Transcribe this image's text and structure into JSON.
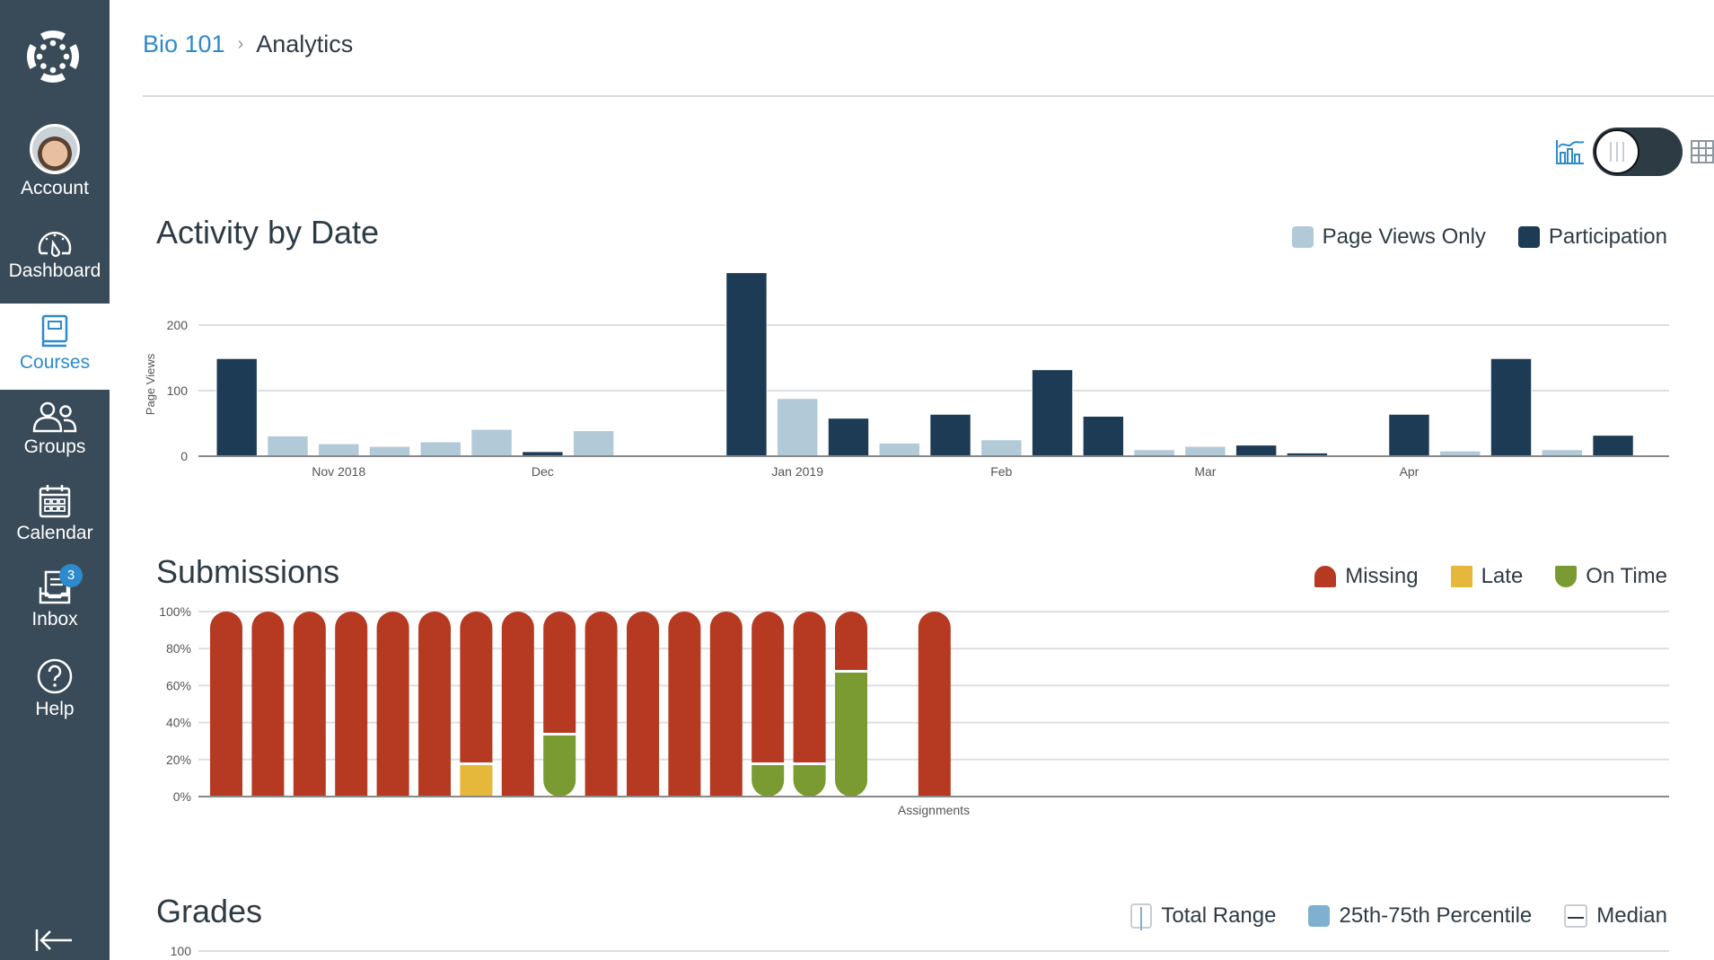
{
  "sidebar": {
    "items": [
      {
        "id": "account",
        "label": "Account",
        "icon": "avatar"
      },
      {
        "id": "dashboard",
        "label": "Dashboard",
        "icon": "speedometer-icon"
      },
      {
        "id": "courses",
        "label": "Courses",
        "icon": "book-icon",
        "active": true
      },
      {
        "id": "groups",
        "label": "Groups",
        "icon": "people-icon"
      },
      {
        "id": "calendar",
        "label": "Calendar",
        "icon": "calendar-icon"
      },
      {
        "id": "inbox",
        "label": "Inbox",
        "icon": "inbox-icon",
        "badge": "3"
      },
      {
        "id": "help",
        "label": "Help",
        "icon": "question-circle-icon"
      }
    ],
    "collapse_icon": "collapse-arrow-icon"
  },
  "breadcrumb": {
    "course": "Bio 101",
    "separator": "›",
    "current": "Analytics"
  },
  "view_toggle": {
    "left_icon": "chart-icon",
    "right_icon": "table-grid-icon",
    "state": "chart"
  },
  "colors": {
    "sidebar_bg": "#394b58",
    "accent": "#2d8acb",
    "participation": "#1d3b54",
    "page_views": "#b2c9d8",
    "missing": "#b63921",
    "late": "#e5b73b",
    "on_time": "#7a9b31",
    "percentile": "#7fb0d0"
  },
  "chart_data": [
    {
      "id": "activity",
      "type": "bar",
      "title": "Activity by Date",
      "ylabel": "Page Views",
      "xlabel": "",
      "ylim": [
        0,
        290
      ],
      "yticks": [
        0,
        100,
        200
      ],
      "grid": true,
      "legend_position": "top-right",
      "legend": [
        {
          "name": "Page Views Only",
          "color": "#b2c9d8"
        },
        {
          "name": "Participation",
          "color": "#1d3b54"
        }
      ],
      "xtick_labels": [
        {
          "label": "Nov 2018",
          "slot": 2.5
        },
        {
          "label": "Dec",
          "slot": 6.5
        },
        {
          "label": "Jan 2019",
          "slot": 11.5
        },
        {
          "label": "Feb",
          "slot": 15.5
        },
        {
          "label": "Mar",
          "slot": 19.5
        },
        {
          "label": "Apr",
          "slot": 23.5
        }
      ],
      "bars": [
        {
          "slot": 0,
          "value": 149,
          "series": "Participation"
        },
        {
          "slot": 1,
          "value": 31,
          "series": "Page Views Only"
        },
        {
          "slot": 2,
          "value": 19,
          "series": "Page Views Only"
        },
        {
          "slot": 3,
          "value": 15,
          "series": "Page Views Only"
        },
        {
          "slot": 4,
          "value": 22,
          "series": "Page Views Only"
        },
        {
          "slot": 5,
          "value": 41,
          "series": "Page Views Only"
        },
        {
          "slot": 6,
          "value": 7,
          "series": "Participation"
        },
        {
          "slot": 7,
          "value": 39,
          "series": "Page Views Only"
        },
        {
          "slot": 10,
          "value": 280,
          "series": "Participation"
        },
        {
          "slot": 11,
          "value": 88,
          "series": "Page Views Only"
        },
        {
          "slot": 12,
          "value": 58,
          "series": "Participation"
        },
        {
          "slot": 13,
          "value": 20,
          "series": "Page Views Only"
        },
        {
          "slot": 14,
          "value": 64,
          "series": "Participation"
        },
        {
          "slot": 15,
          "value": 25,
          "series": "Page Views Only"
        },
        {
          "slot": 16,
          "value": 132,
          "series": "Participation"
        },
        {
          "slot": 17,
          "value": 61,
          "series": "Participation"
        },
        {
          "slot": 18,
          "value": 10,
          "series": "Page Views Only"
        },
        {
          "slot": 19,
          "value": 15,
          "series": "Page Views Only"
        },
        {
          "slot": 20,
          "value": 17,
          "series": "Participation"
        },
        {
          "slot": 21,
          "value": 5,
          "series": "Participation"
        },
        {
          "slot": 23,
          "value": 64,
          "series": "Participation"
        },
        {
          "slot": 24,
          "value": 8,
          "series": "Page Views Only"
        },
        {
          "slot": 25,
          "value": 149,
          "series": "Participation"
        },
        {
          "slot": 26,
          "value": 10,
          "series": "Page Views Only"
        },
        {
          "slot": 27,
          "value": 32,
          "series": "Participation"
        }
      ],
      "total_slots": 28.5
    },
    {
      "id": "submissions",
      "type": "bar",
      "stacked": true,
      "title": "Submissions",
      "xlabel": "Assignments",
      "ylabel": "",
      "ylim": [
        0,
        100
      ],
      "yticks": [
        "0%",
        "20%",
        "40%",
        "60%",
        "80%",
        "100%"
      ],
      "grid": true,
      "legend_position": "top-right",
      "legend": [
        {
          "name": "Missing",
          "color": "#b63921"
        },
        {
          "name": "Late",
          "color": "#e5b73b"
        },
        {
          "name": "On Time",
          "color": "#7a9b31"
        }
      ],
      "assignments": [
        {
          "slot": 0,
          "on_time": 0,
          "late": 0,
          "missing": 100
        },
        {
          "slot": 1,
          "on_time": 0,
          "late": 0,
          "missing": 100
        },
        {
          "slot": 2,
          "on_time": 0,
          "late": 0,
          "missing": 100
        },
        {
          "slot": 3,
          "on_time": 0,
          "late": 0,
          "missing": 100
        },
        {
          "slot": 4,
          "on_time": 0,
          "late": 0,
          "missing": 100
        },
        {
          "slot": 5,
          "on_time": 0,
          "late": 0,
          "missing": 100
        },
        {
          "slot": 6,
          "on_time": 0,
          "late": 17,
          "missing": 83
        },
        {
          "slot": 7,
          "on_time": 0,
          "late": 0,
          "missing": 100
        },
        {
          "slot": 8,
          "on_time": 33,
          "late": 0,
          "missing": 67
        },
        {
          "slot": 9,
          "on_time": 0,
          "late": 0,
          "missing": 100
        },
        {
          "slot": 10,
          "on_time": 0,
          "late": 0,
          "missing": 100
        },
        {
          "slot": 11,
          "on_time": 0,
          "late": 0,
          "missing": 100
        },
        {
          "slot": 12,
          "on_time": 0,
          "late": 0,
          "missing": 100
        },
        {
          "slot": 13,
          "on_time": 17,
          "late": 0,
          "missing": 83
        },
        {
          "slot": 14,
          "on_time": 17,
          "late": 0,
          "missing": 83
        },
        {
          "slot": 15,
          "on_time": 67,
          "late": 0,
          "missing": 33
        },
        {
          "slot": 17,
          "on_time": 0,
          "late": 0,
          "missing": 100
        }
      ]
    },
    {
      "id": "grades",
      "type": "bar",
      "title": "Grades",
      "ylim": [
        0,
        100
      ],
      "yticks": [
        100
      ],
      "legend_position": "top-right",
      "legend": [
        {
          "name": "Total Range",
          "style": "range"
        },
        {
          "name": "25th-75th Percentile",
          "color": "#7fb0d0"
        },
        {
          "name": "Median",
          "style": "median"
        }
      ]
    }
  ]
}
